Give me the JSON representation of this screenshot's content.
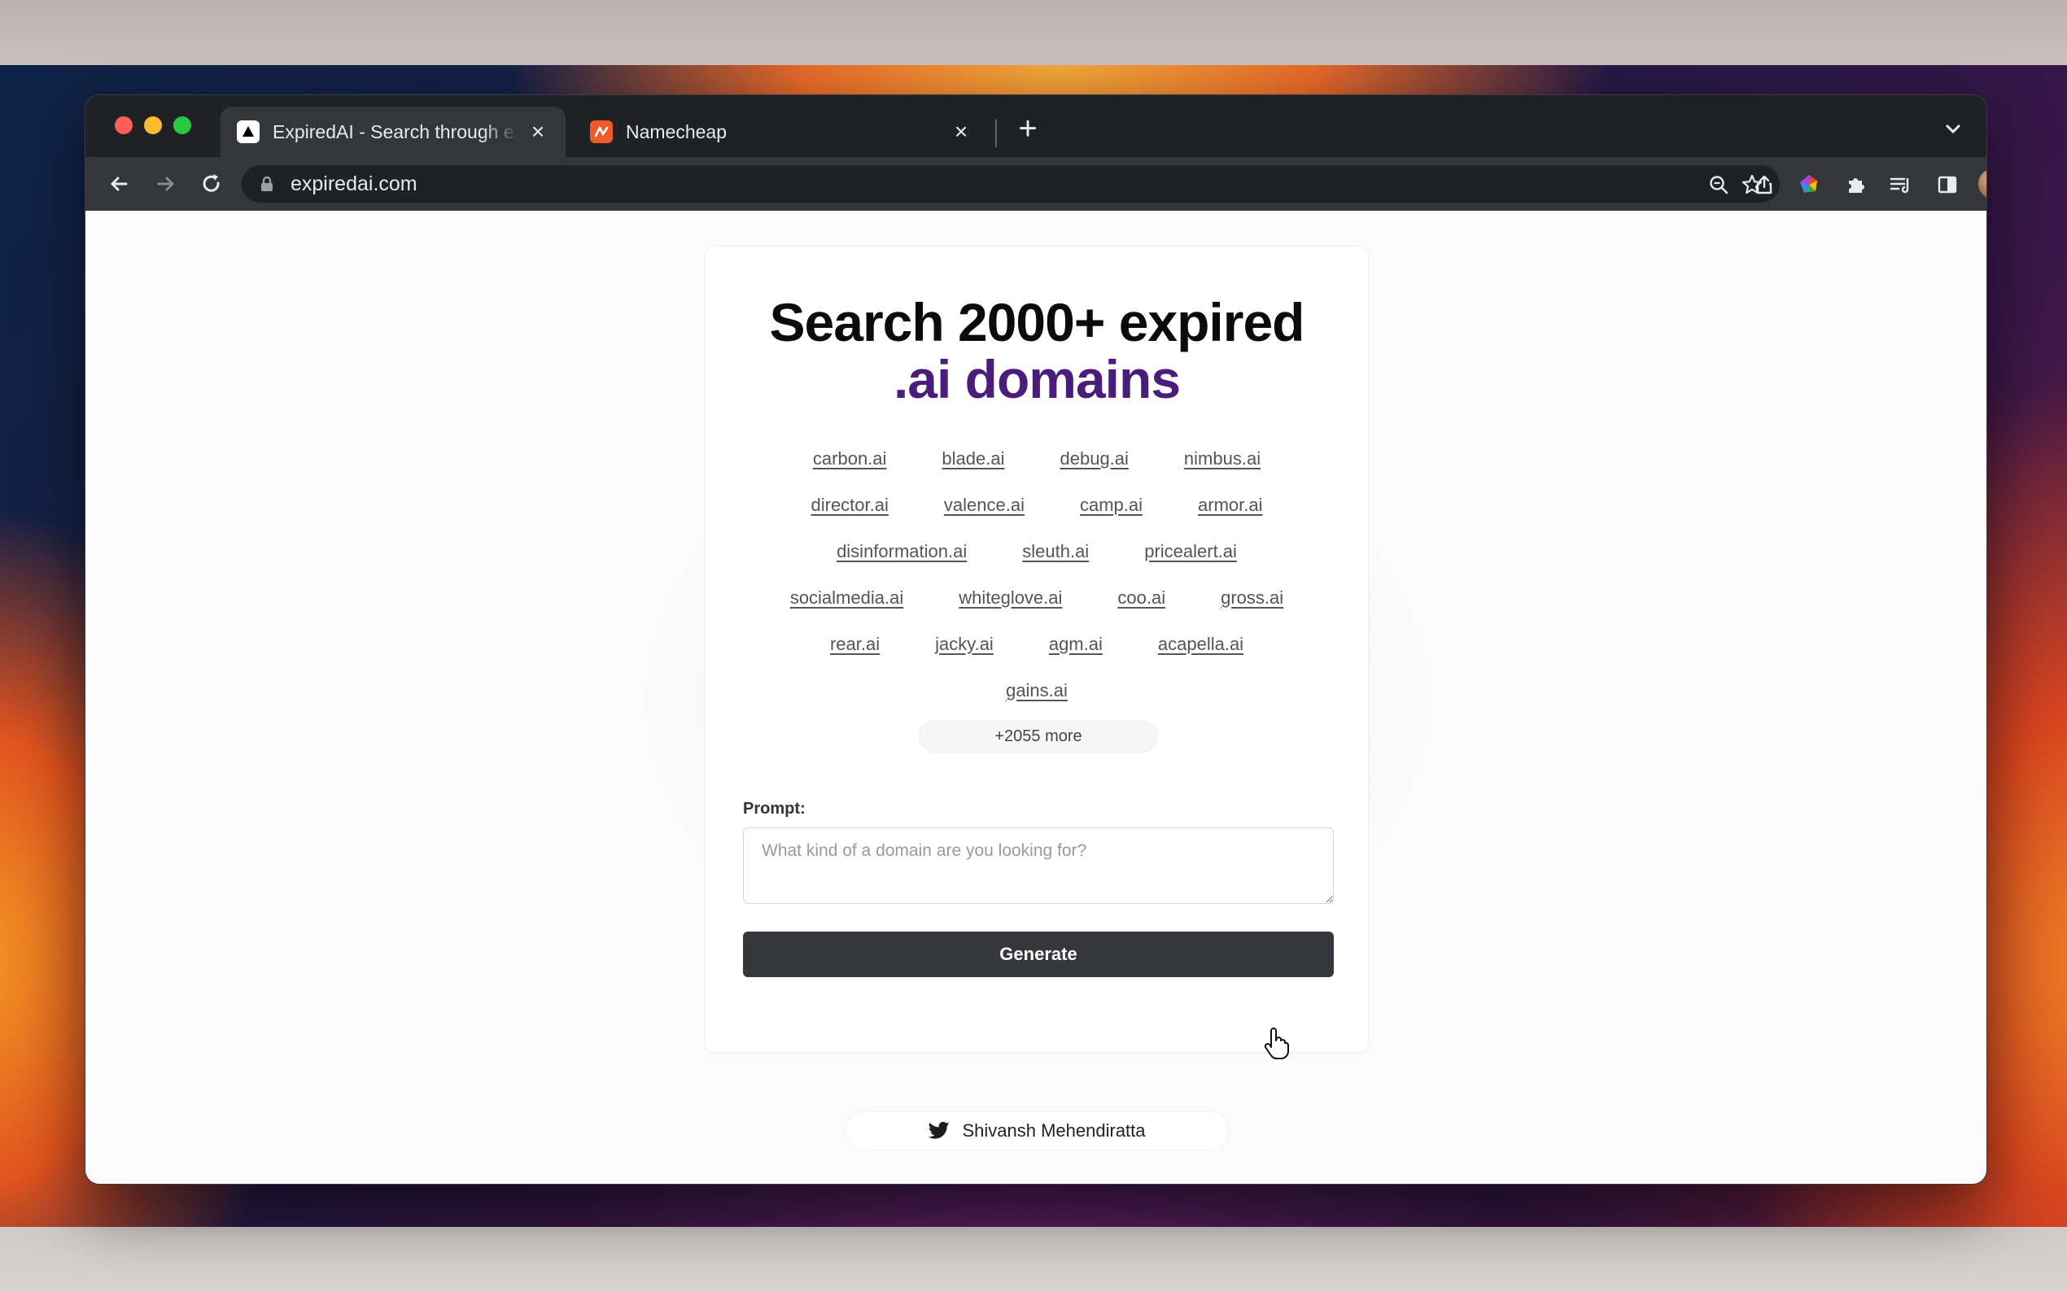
{
  "browser": {
    "tabs": [
      {
        "title": "ExpiredAI - Search through exp",
        "favicon": "triangle-logo-icon",
        "active": true
      },
      {
        "title": "Namecheap",
        "favicon": "namecheap-logo-icon",
        "active": false
      }
    ],
    "url": "expiredai.com"
  },
  "page": {
    "headline_line1": "Search 2000+ expired",
    "headline_line2": ".ai domains",
    "accent_color": "#4a1d7a",
    "domain_rows": [
      [
        "carbon.ai",
        "blade.ai",
        "debug.ai",
        "nimbus.ai"
      ],
      [
        "director.ai",
        "valence.ai",
        "camp.ai",
        "armor.ai"
      ],
      [
        "disinformation.ai",
        "sleuth.ai",
        "pricealert.ai"
      ],
      [
        "socialmedia.ai",
        "whiteglove.ai",
        "coo.ai",
        "gross.ai"
      ],
      [
        "rear.ai",
        "jacky.ai",
        "agm.ai",
        "acapella.ai"
      ],
      [
        "gains.ai"
      ]
    ],
    "more_label": "+2055 more",
    "prompt_label": "Prompt:",
    "prompt_placeholder": "What kind of a domain are you looking for?",
    "generate_label": "Generate",
    "footer_name": "Shivansh Mehendiratta"
  }
}
